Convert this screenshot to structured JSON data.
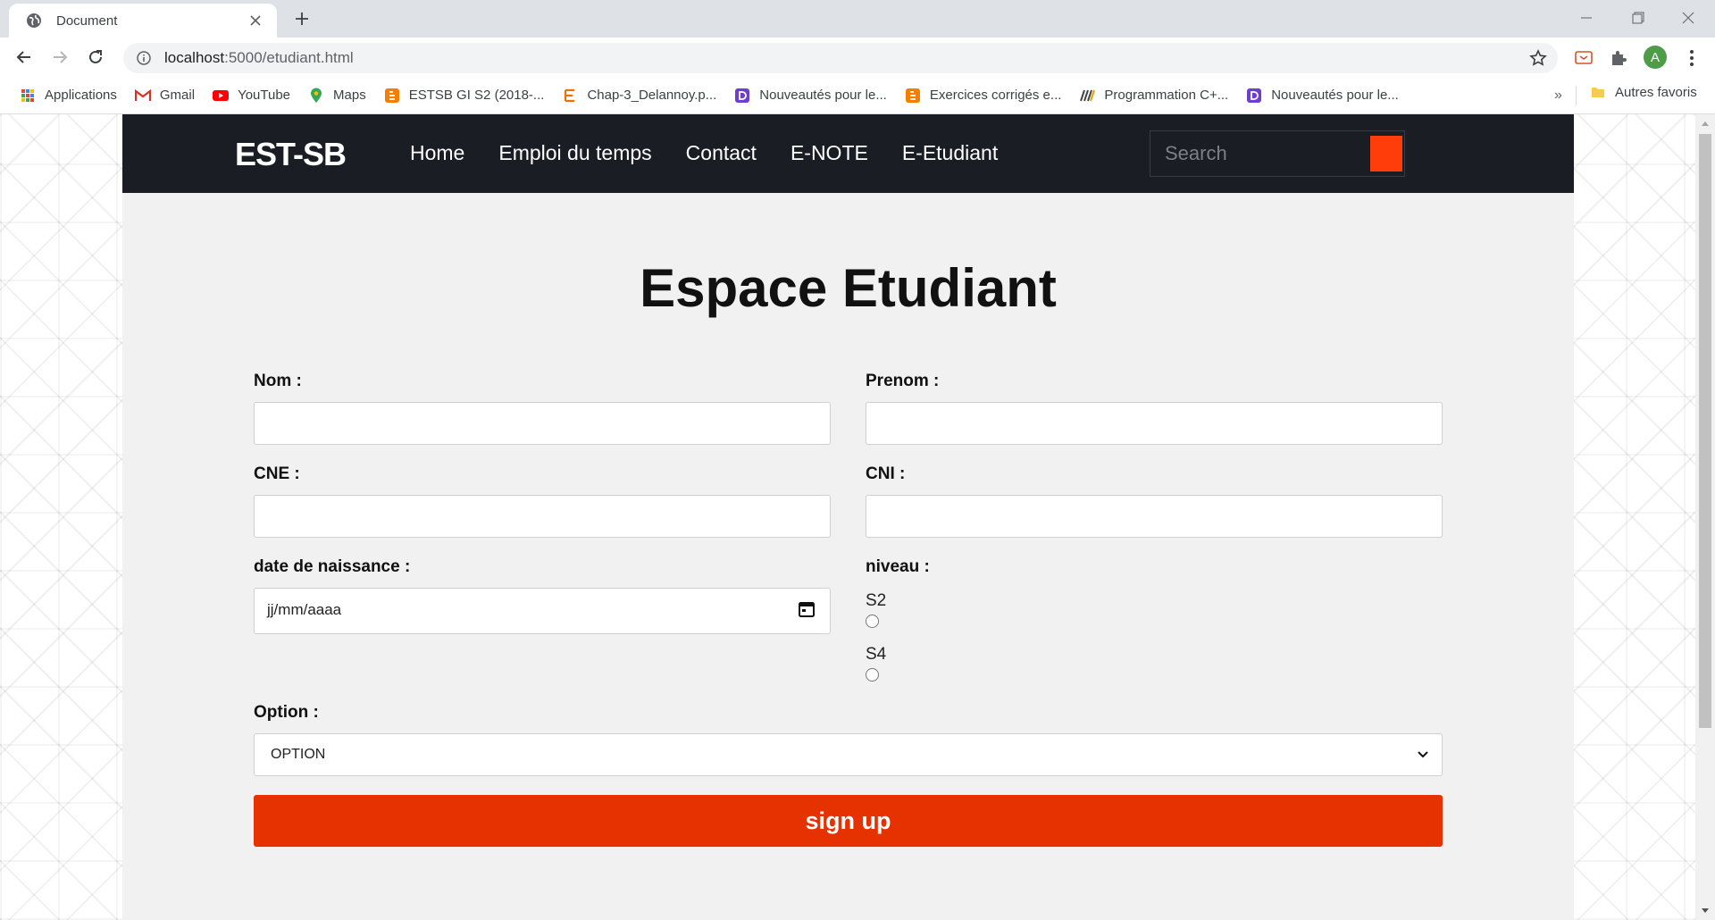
{
  "browser": {
    "tab_title": "Document",
    "url_host": "localhost",
    "url_path": ":5000/etudiant.html",
    "bookmarks": [
      {
        "label": "Applications",
        "icon": "apps-grid-icon"
      },
      {
        "label": "Gmail",
        "icon": "gmail-icon"
      },
      {
        "label": "YouTube",
        "icon": "youtube-icon"
      },
      {
        "label": "Maps",
        "icon": "maps-pin-icon"
      },
      {
        "label": "ESTSB GI S2 (2018-...",
        "icon": "blogger-icon"
      },
      {
        "label": "Chap-3_Delannoy.p...",
        "icon": "document-e-icon"
      },
      {
        "label": "Nouveautés pour le...",
        "icon": "purple-d-icon"
      },
      {
        "label": "Exercices corrigés e...",
        "icon": "blogger-icon"
      },
      {
        "label": "Programmation C+...",
        "icon": "stack-icon"
      },
      {
        "label": "Nouveautés pour le...",
        "icon": "purple-d-icon"
      }
    ],
    "bookmarks_more": "»",
    "other_bookmarks": "Autres favoris",
    "profile_initial": "A"
  },
  "navbar": {
    "brand": "EST-SB",
    "links": [
      "Home",
      "Emploi du temps",
      "Contact",
      "E-NOTE",
      "E-Etudiant"
    ],
    "search_placeholder": "Search"
  },
  "page": {
    "title": "Espace Etudiant"
  },
  "form": {
    "nom_label": "Nom :",
    "prenom_label": "Prenom :",
    "cne_label": "CNE :",
    "cni_label": "CNI :",
    "date_label": "date de naissance :",
    "date_placeholder": "jj/mm/aaaa",
    "niveau_label": "niveau :",
    "niveau_options": [
      "S2",
      "S4"
    ],
    "option_label": "Option :",
    "option_selected": "OPTION",
    "submit_label": "sign up"
  },
  "colors": {
    "navbar_bg": "#1b1d24",
    "accent": "#e63200",
    "search_button": "#ff3d0a",
    "content_bg": "#f1f1f1"
  }
}
